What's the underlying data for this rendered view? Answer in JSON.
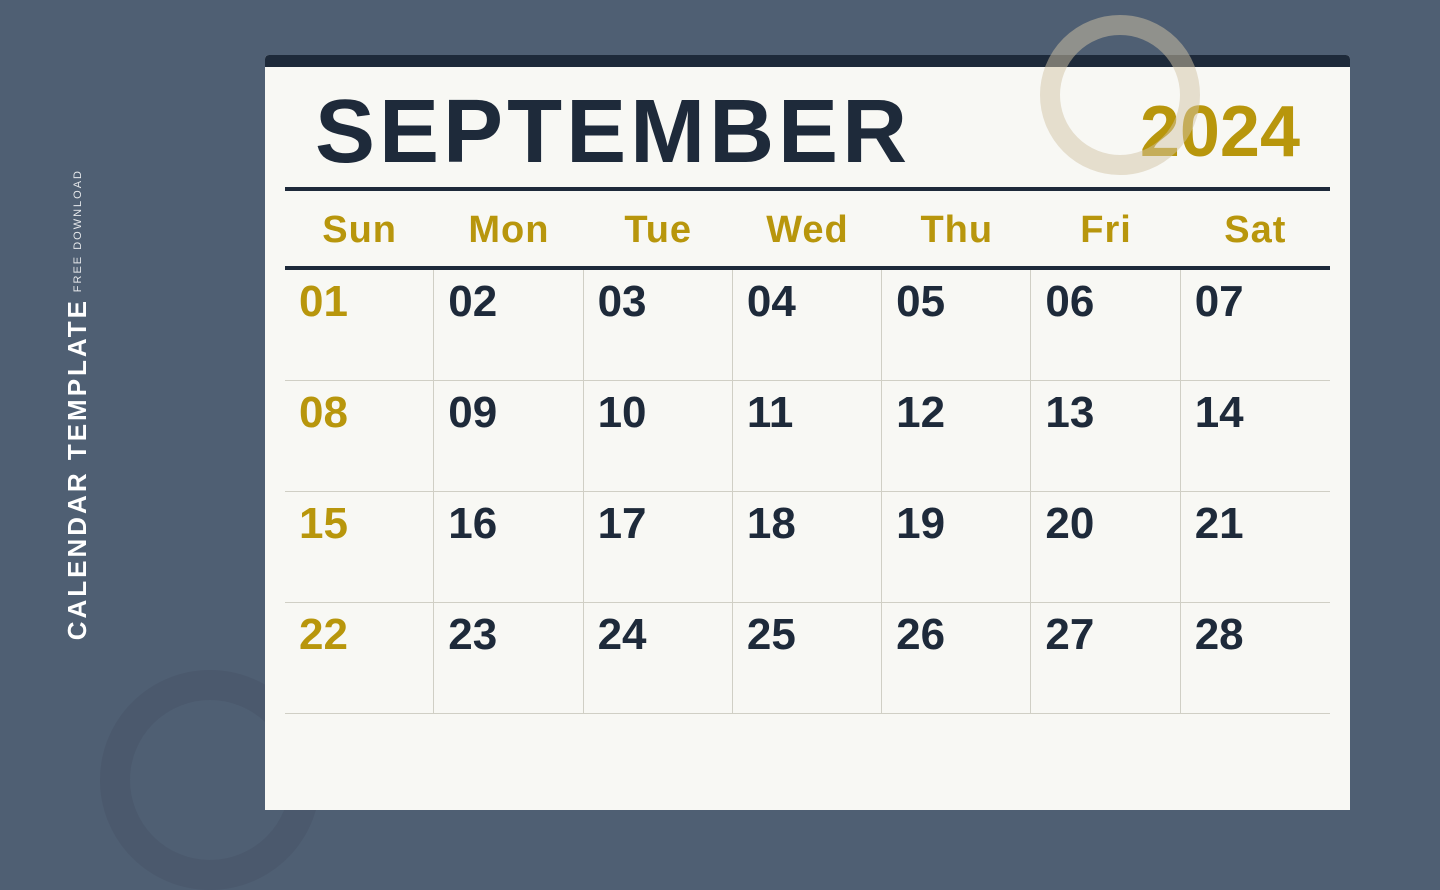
{
  "background": {
    "color": "#4f5f73"
  },
  "sidebar": {
    "free_download_label": "FREE DOWNLOAD",
    "calendar_template_label": "CALENDAR TEMPLATE"
  },
  "calendar": {
    "month": "SEPTEMBER",
    "year": "2024",
    "day_headers": [
      "Sun",
      "Mon",
      "Tue",
      "Wed",
      "Thu",
      "Fri",
      "Sat"
    ],
    "weeks": [
      [
        "01",
        "02",
        "03",
        "04",
        "05",
        "06",
        "07"
      ],
      [
        "08",
        "09",
        "10",
        "11",
        "12",
        "13",
        "14"
      ],
      [
        "15",
        "16",
        "17",
        "18",
        "19",
        "20",
        "21"
      ],
      [
        "22",
        "23",
        "24",
        "25",
        "26",
        "27",
        "28"
      ]
    ]
  }
}
